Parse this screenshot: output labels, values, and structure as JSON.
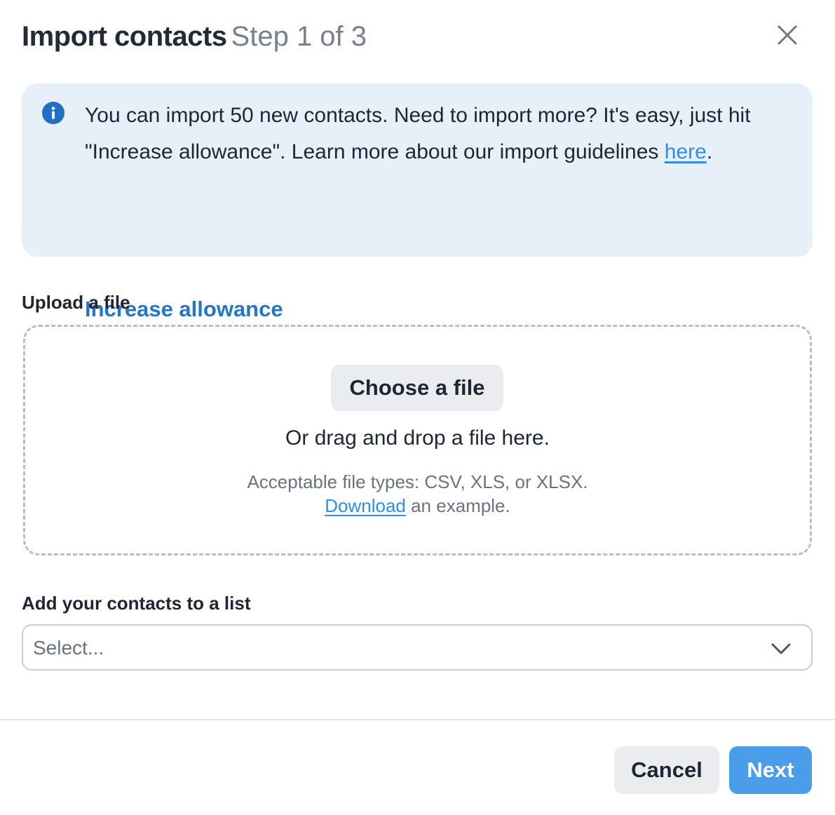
{
  "header": {
    "title": "Import contacts",
    "step": "Step 1 of 3"
  },
  "info": {
    "text_before_link": "You can import 50 new contacts. Need to import more? It's easy, just hit \"Increase allowance\". Learn more about our import guidelines ",
    "link_label": "here",
    "text_after_link": ".",
    "action_label": "Increase allowance"
  },
  "upload": {
    "label": "Upload a file",
    "choose_label": "Choose a file",
    "drag_text": "Or drag and drop a file here.",
    "types_text": "Acceptable file types: CSV, XLS, or XLSX.",
    "download_label": "Download",
    "example_suffix": " an example."
  },
  "list": {
    "label": "Add your contacts to a list",
    "placeholder": "Select..."
  },
  "footer": {
    "cancel_label": "Cancel",
    "next_label": "Next"
  },
  "icons": {
    "close": "close-icon",
    "info": "info-icon",
    "chevron": "chevron-down-icon"
  },
  "colors": {
    "accent": "#4a9de9",
    "link": "#2f8ee5",
    "action_link": "#2476c7",
    "info_bg": "#e7eff8",
    "info_icon": "#1f6fc5"
  }
}
